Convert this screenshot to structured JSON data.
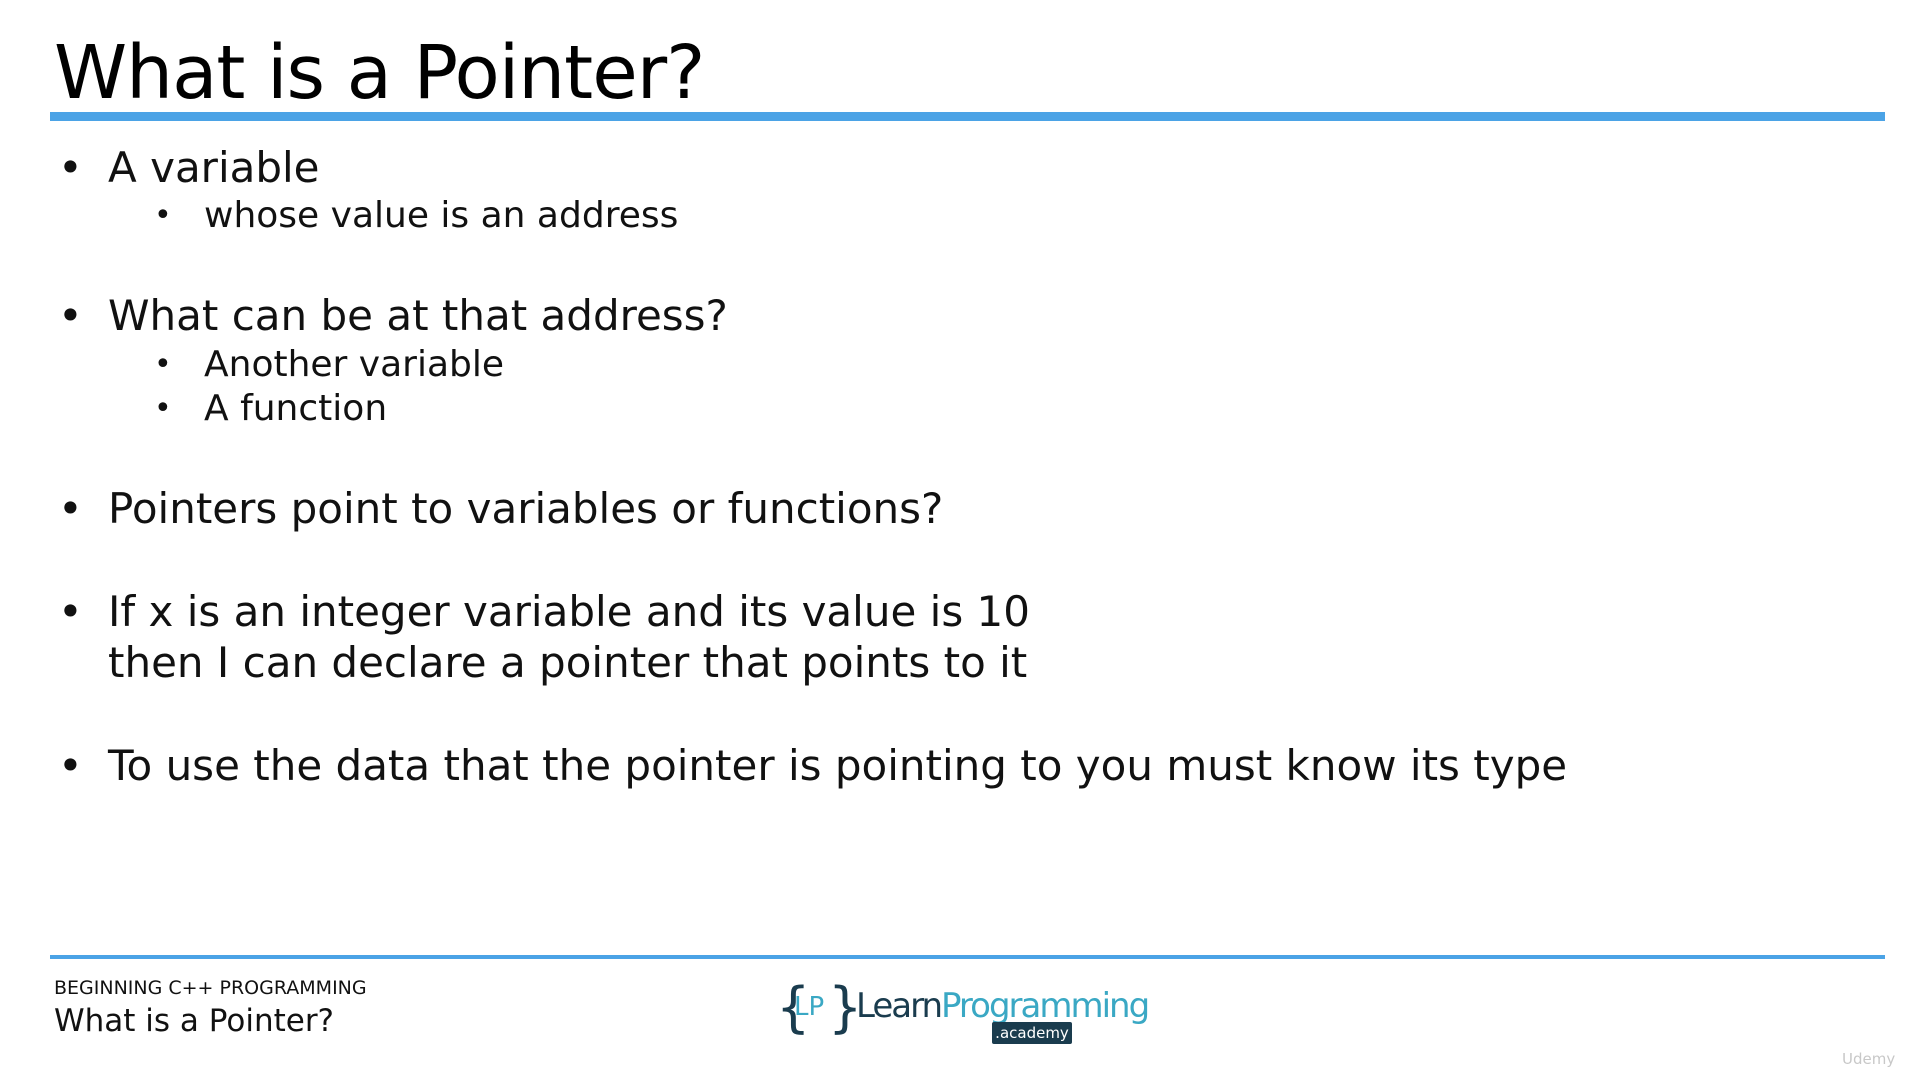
{
  "slide": {
    "title": "What is a Pointer?"
  },
  "bullets": [
    {
      "text": "A variable",
      "sub": [
        "whose value is an address"
      ]
    },
    {
      "text": "What can be at that address?",
      "sub": [
        "Another variable",
        "A function"
      ]
    },
    {
      "text": "Pointers point to variables or functions?",
      "sub": []
    },
    {
      "text_line1": "If x is an integer variable and its value is 10",
      "text_line2": "then I can declare a pointer that points to it",
      "sub": []
    },
    {
      "text": "To use the data that the pointer is pointing to you must know its type",
      "sub": []
    }
  ],
  "footer": {
    "course": "BEGINNING C++ PROGRAMMING",
    "lesson": "What is a Pointer?"
  },
  "logo": {
    "brace_left": "{",
    "initials": "LP",
    "brace_right": "}",
    "name_part1": "Learn",
    "name_part2": "Programming",
    "badge": ".academy"
  },
  "watermark": "Udemy",
  "colors": {
    "accent_rule": "#4ba3e6",
    "logo_dark": "#1a3c4e",
    "logo_light": "#3aa8c4"
  }
}
